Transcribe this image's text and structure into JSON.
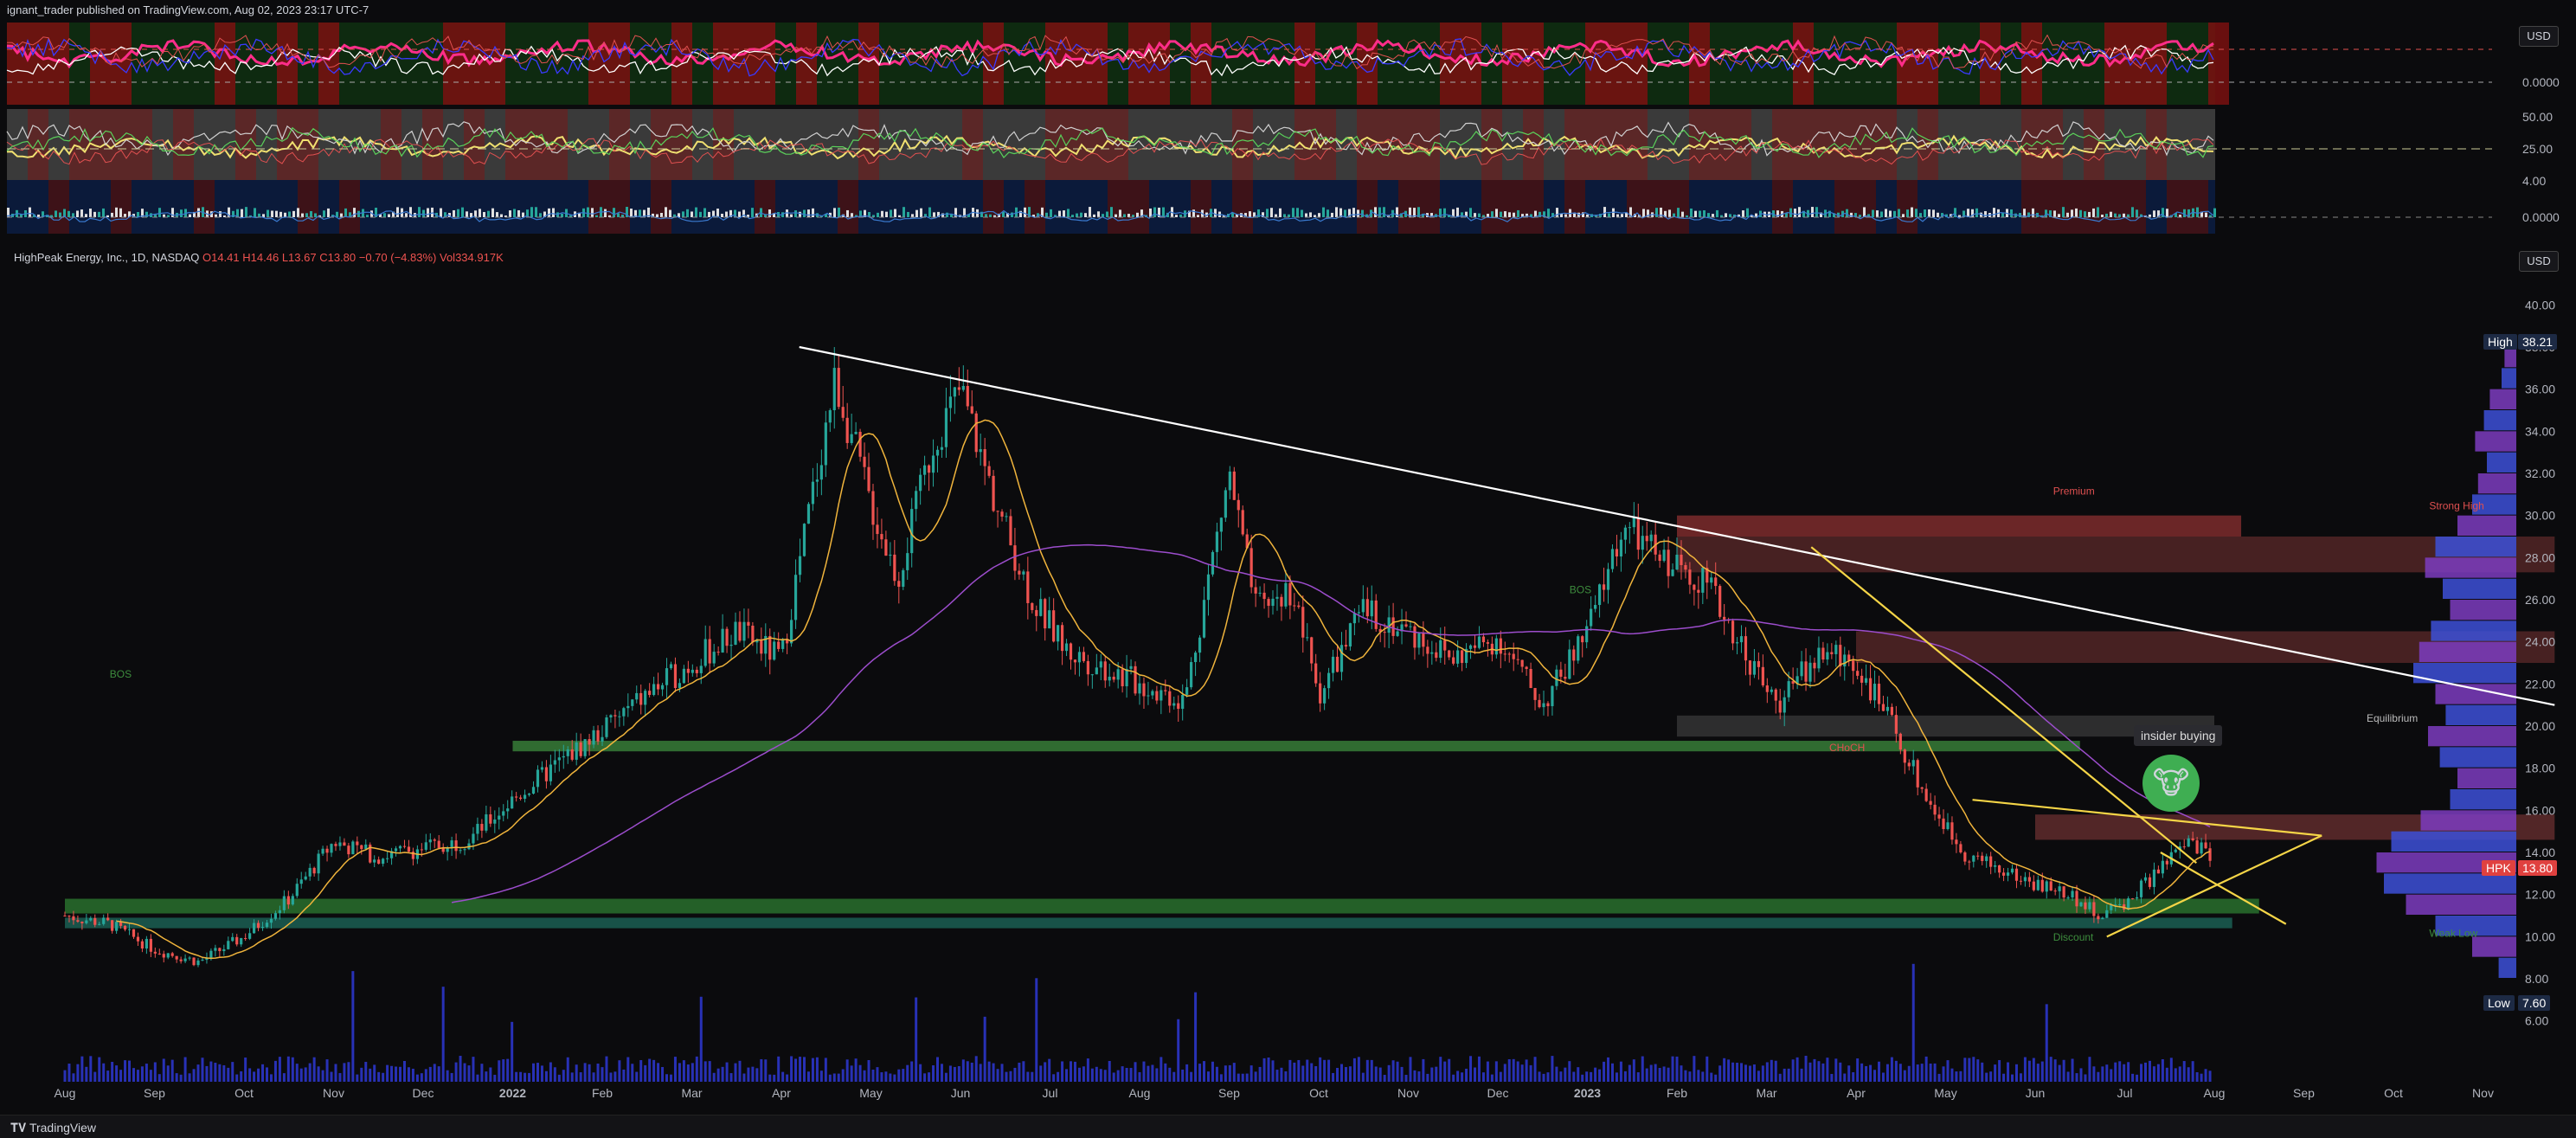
{
  "header": {
    "publish_text": "ignant_trader published on TradingView.com, Aug 02, 2023 23:17 UTC-7"
  },
  "legend": {
    "symbol_text": "HighPeak Energy, Inc., 1D, NASDAQ",
    "open": "O14.41",
    "high": "H14.46",
    "low": "L13.67",
    "close": "C13.80",
    "change": "−0.70 (−4.83%)",
    "volume": "Vol334.917K"
  },
  "scale": {
    "currency_top": "USD",
    "currency_main": "USD",
    "high_label": "High",
    "high_value": "38.21",
    "low_label": "Low",
    "low_value": "7.60",
    "last_label": "HPK",
    "last_value": "13.80"
  },
  "annotations": {
    "insider": "insider buying",
    "equilibrium": "Equilibrium",
    "premium": "Premium",
    "discount": "Discount",
    "strong_high": "Strong High",
    "weak_low": "Weak Low",
    "bos": "BOS",
    "choch": "CHoCH"
  },
  "footer": {
    "brand": "TradingView"
  },
  "colors": {
    "up": "#26a69a",
    "down": "#ef5350",
    "trend_white": "#ffffff",
    "trend_yellow": "#f5d547",
    "ma_orange": "#f0b43c",
    "ma_purple": "#9c4dcc",
    "zone_green": "#3d8c3d",
    "zone_red": "#8c3030",
    "volume_blue": "#2b35c9",
    "profile_blue": "#2962ff"
  },
  "chart_data": {
    "type": "candlestick",
    "x_labels": [
      "Aug",
      "Sep",
      "Oct",
      "Nov",
      "Dec",
      "2022",
      "Feb",
      "Mar",
      "Apr",
      "May",
      "Jun",
      "Jul",
      "Aug",
      "Sep",
      "Oct",
      "Nov",
      "Dec",
      "2023",
      "Feb",
      "Mar",
      "Apr",
      "May",
      "Jun",
      "Jul",
      "Aug",
      "Sep",
      "Oct",
      "Nov"
    ],
    "y_ticks": [
      6,
      8,
      10,
      12,
      14,
      16,
      18,
      20,
      22,
      24,
      26,
      28,
      30,
      32,
      34,
      36,
      38,
      40
    ],
    "y_tick_labels": [
      "6.00",
      "8.00",
      "10.00",
      "12.00",
      "14.00",
      "16.00",
      "18.00",
      "20.00",
      "22.00",
      "24.00",
      "26.00",
      "28.00",
      "30.00",
      "32.00",
      "34.00",
      "36.00",
      "38.00",
      "40.00"
    ],
    "ylim": [
      5,
      41
    ],
    "high": 38.21,
    "low": 7.6,
    "last": 13.8,
    "price_path": [
      {
        "m": 0,
        "p": 11.0
      },
      {
        "m": 0.5,
        "p": 10.6
      },
      {
        "m": 1,
        "p": 9.4
      },
      {
        "m": 1.5,
        "p": 8.8
      },
      {
        "m": 2,
        "p": 10.0
      },
      {
        "m": 2.5,
        "p": 11.8
      },
      {
        "m": 3,
        "p": 14.5
      },
      {
        "m": 3.5,
        "p": 13.8
      },
      {
        "m": 4,
        "p": 14.2
      },
      {
        "m": 4.5,
        "p": 14.6
      },
      {
        "m": 5,
        "p": 16.5
      },
      {
        "m": 5.5,
        "p": 18.2
      },
      {
        "m": 6,
        "p": 19.8
      },
      {
        "m": 6.5,
        "p": 21.5
      },
      {
        "m": 7,
        "p": 23.0
      },
      {
        "m": 7.5,
        "p": 24.5
      },
      {
        "m": 8,
        "p": 23.2
      },
      {
        "m": 8.3,
        "p": 30.0
      },
      {
        "m": 8.6,
        "p": 36.5
      },
      {
        "m": 9,
        "p": 30.5
      },
      {
        "m": 9.3,
        "p": 27.0
      },
      {
        "m": 9.7,
        "p": 33.5
      },
      {
        "m": 10,
        "p": 36.0
      },
      {
        "m": 10.4,
        "p": 30.5
      },
      {
        "m": 10.8,
        "p": 26.0
      },
      {
        "m": 11.2,
        "p": 23.5
      },
      {
        "m": 11.6,
        "p": 22.8
      },
      {
        "m": 12,
        "p": 22.0
      },
      {
        "m": 12.5,
        "p": 21.2
      },
      {
        "m": 13,
        "p": 32.0
      },
      {
        "m": 13.3,
        "p": 25.5
      },
      {
        "m": 13.7,
        "p": 26.5
      },
      {
        "m": 14,
        "p": 21.5
      },
      {
        "m": 14.5,
        "p": 25.5
      },
      {
        "m": 15,
        "p": 24.5
      },
      {
        "m": 15.5,
        "p": 23.2
      },
      {
        "m": 16,
        "p": 24.2
      },
      {
        "m": 16.5,
        "p": 21.0
      },
      {
        "m": 17,
        "p": 24.5
      },
      {
        "m": 17.4,
        "p": 29.5
      },
      {
        "m": 17.8,
        "p": 28.0
      },
      {
        "m": 18.3,
        "p": 27.0
      },
      {
        "m": 18.7,
        "p": 24.0
      },
      {
        "m": 19.1,
        "p": 21.0
      },
      {
        "m": 19.6,
        "p": 23.5
      },
      {
        "m": 20,
        "p": 23.0
      },
      {
        "m": 20.4,
        "p": 20.0
      },
      {
        "m": 20.8,
        "p": 16.5
      },
      {
        "m": 21.2,
        "p": 14.0
      },
      {
        "m": 21.6,
        "p": 13.2
      },
      {
        "m": 22,
        "p": 12.5
      },
      {
        "m": 22.4,
        "p": 12.0
      },
      {
        "m": 22.7,
        "p": 11.0
      },
      {
        "m": 23,
        "p": 11.6
      },
      {
        "m": 23.4,
        "p": 13.2
      },
      {
        "m": 23.7,
        "p": 14.5
      },
      {
        "m": 24,
        "p": 13.8
      }
    ],
    "trendlines": [
      {
        "name": "descending-resistance",
        "x0": 8.2,
        "y0": 38.0,
        "x1": 27.8,
        "y1": 21.0
      },
      {
        "name": "yellow-upper-1",
        "x0": 19.5,
        "y0": 28.5,
        "x1": 23.8,
        "y1": 13.5
      },
      {
        "name": "yellow-upper-2",
        "x0": 21.3,
        "y0": 16.5,
        "x1": 25.2,
        "y1": 14.8
      },
      {
        "name": "yellow-lower",
        "x0": 22.8,
        "y0": 10.0,
        "x1": 25.2,
        "y1": 14.8
      },
      {
        "name": "yellow-wedge",
        "x0": 23.4,
        "y0": 14.0,
        "x1": 24.8,
        "y1": 10.6
      }
    ],
    "zones": [
      {
        "name": "support-green-1",
        "y0": 19.3,
        "y1": 18.8,
        "x0": 5.0,
        "x1": 22.5,
        "color": "#3d8c3d"
      },
      {
        "name": "support-green-2",
        "y0": 11.8,
        "y1": 11.1,
        "x0": 0,
        "x1": 24.5,
        "color": "#2e7d32"
      },
      {
        "name": "support-teal",
        "y0": 10.9,
        "y1": 10.4,
        "x0": 0,
        "x1": 24.2,
        "color": "#1d6b5c"
      },
      {
        "name": "premium-red-1",
        "y0": 30.0,
        "y1": 29.0,
        "x0": 18.0,
        "x1": 24.3,
        "color": "#8c3030"
      },
      {
        "name": "premium-red-2",
        "y0": 29.0,
        "y1": 27.3,
        "x0": 18.0,
        "x1": 27.8,
        "color": "#5c2a2a"
      },
      {
        "name": "premium-red-3",
        "y0": 24.5,
        "y1": 23.0,
        "x0": 20.0,
        "x1": 27.8,
        "color": "#5c2a2a"
      },
      {
        "name": "equilibrium-grey",
        "y0": 20.5,
        "y1": 19.5,
        "x0": 18.0,
        "x1": 24.0,
        "color": "#3a3a3a"
      },
      {
        "name": "resistance-red",
        "y0": 15.8,
        "y1": 14.6,
        "x0": 22.0,
        "x1": 27.8,
        "color": "#6b3030"
      }
    ],
    "volume_profile": [
      {
        "p": 37.5,
        "v": 0.08
      },
      {
        "p": 36.5,
        "v": 0.1
      },
      {
        "p": 35.5,
        "v": 0.18
      },
      {
        "p": 34.5,
        "v": 0.22
      },
      {
        "p": 33.5,
        "v": 0.28
      },
      {
        "p": 32.5,
        "v": 0.2
      },
      {
        "p": 31.5,
        "v": 0.26
      },
      {
        "p": 30.5,
        "v": 0.3
      },
      {
        "p": 29.5,
        "v": 0.4
      },
      {
        "p": 28.5,
        "v": 0.55
      },
      {
        "p": 27.5,
        "v": 0.62
      },
      {
        "p": 26.5,
        "v": 0.5
      },
      {
        "p": 25.5,
        "v": 0.45
      },
      {
        "p": 24.5,
        "v": 0.58
      },
      {
        "p": 23.5,
        "v": 0.66
      },
      {
        "p": 22.5,
        "v": 0.7
      },
      {
        "p": 21.5,
        "v": 0.55
      },
      {
        "p": 20.5,
        "v": 0.48
      },
      {
        "p": 19.5,
        "v": 0.6
      },
      {
        "p": 18.5,
        "v": 0.52
      },
      {
        "p": 17.5,
        "v": 0.4
      },
      {
        "p": 16.5,
        "v": 0.45
      },
      {
        "p": 15.5,
        "v": 0.65
      },
      {
        "p": 14.5,
        "v": 0.85
      },
      {
        "p": 13.5,
        "v": 0.95
      },
      {
        "p": 12.5,
        "v": 0.9
      },
      {
        "p": 11.5,
        "v": 0.75
      },
      {
        "p": 10.5,
        "v": 0.55
      },
      {
        "p": 9.5,
        "v": 0.3
      },
      {
        "p": 8.5,
        "v": 0.12
      }
    ]
  },
  "indicator_panels": [
    {
      "name": "panel-1",
      "tick_label": "0.0000",
      "tick_value": 0
    },
    {
      "name": "panel-2",
      "tick_labels": [
        "50.00",
        "25.00"
      ],
      "tick_values": [
        50,
        25
      ]
    },
    {
      "name": "panel-3",
      "tick_labels": [
        "4.00",
        "0.0000"
      ],
      "tick_values": [
        4,
        0
      ]
    }
  ]
}
